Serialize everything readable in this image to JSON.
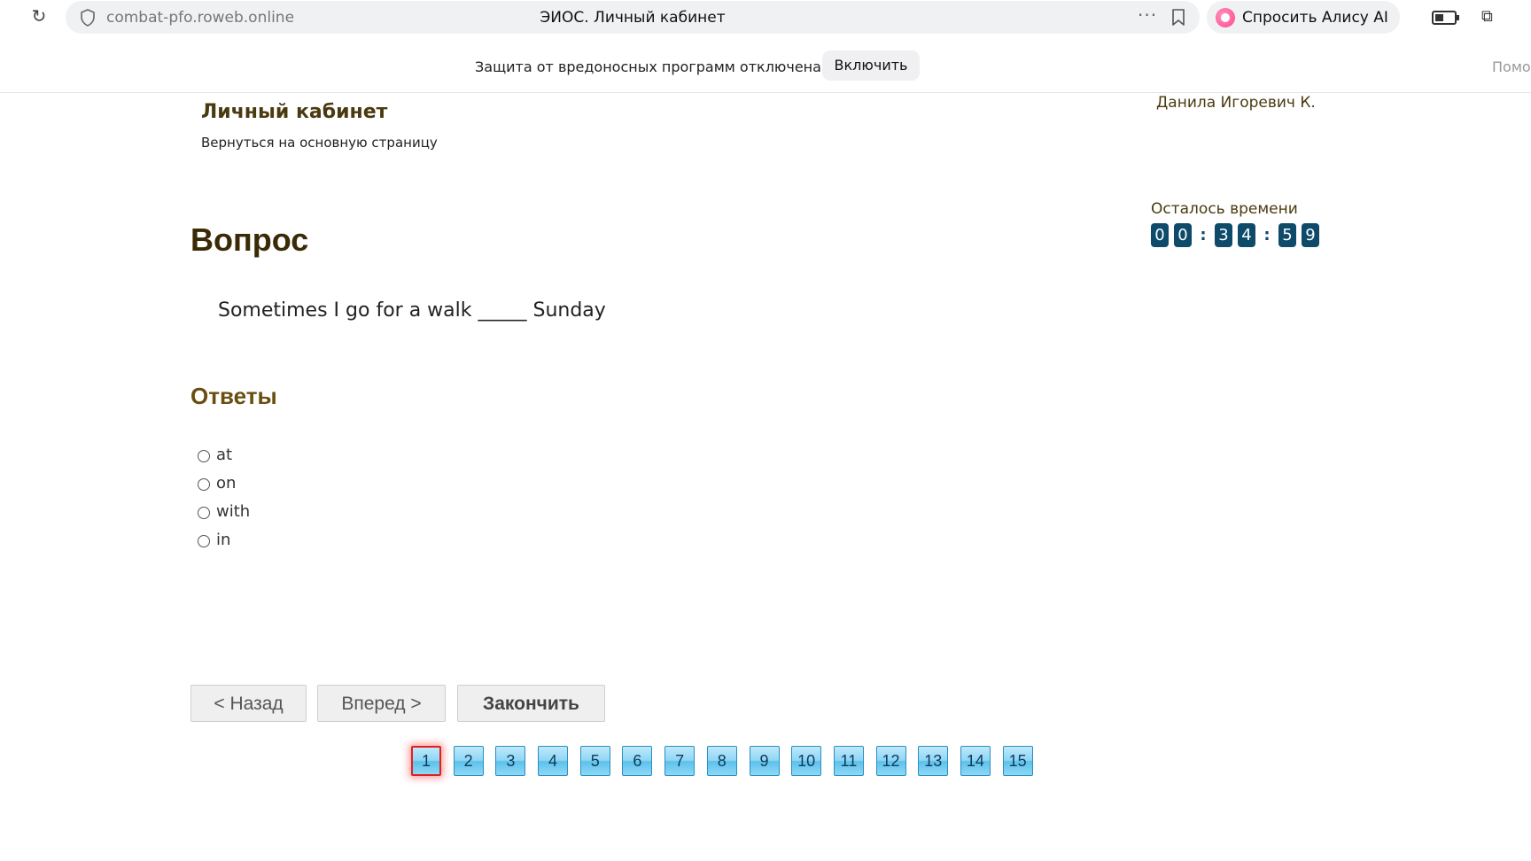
{
  "browser": {
    "domain": "combat-pfo.roweb.online",
    "page_title": "ЭИОС. Личный кабинет",
    "more_icon": "···",
    "alice_button": "Спросить Алису AI"
  },
  "infobar": {
    "message": "Защита от вредоносных программ отключена",
    "enable_button": "Включить",
    "help_cut": "Помо"
  },
  "header": {
    "title": "Личный кабинет",
    "back_link": "Вернуться на основную страницу",
    "user_name": "Данила Игоревич К."
  },
  "timer": {
    "label": "Осталось времени",
    "d0": "0",
    "d1": "0",
    "d2": "3",
    "d3": "4",
    "d4": "5",
    "d5": "9",
    "sep": ":"
  },
  "question": {
    "heading": "Вопрос",
    "text": "Sometimes I go for a walk _____ Sunday"
  },
  "answers": {
    "heading": "Ответы",
    "options": [
      "at",
      "on",
      "with",
      "in"
    ]
  },
  "nav": {
    "back": "< Назад",
    "next": "Вперед >",
    "finish": "Закончить"
  },
  "pager": {
    "current": "1",
    "pages": [
      "1",
      "2",
      "3",
      "4",
      "5",
      "6",
      "7",
      "8",
      "9",
      "10",
      "11",
      "12",
      "13",
      "14",
      "15"
    ]
  },
  "colors": {
    "timer_digit_bg": "#0e4a6a",
    "heading_brown": "#4a3a10",
    "pager_current_border": "#e02020"
  }
}
